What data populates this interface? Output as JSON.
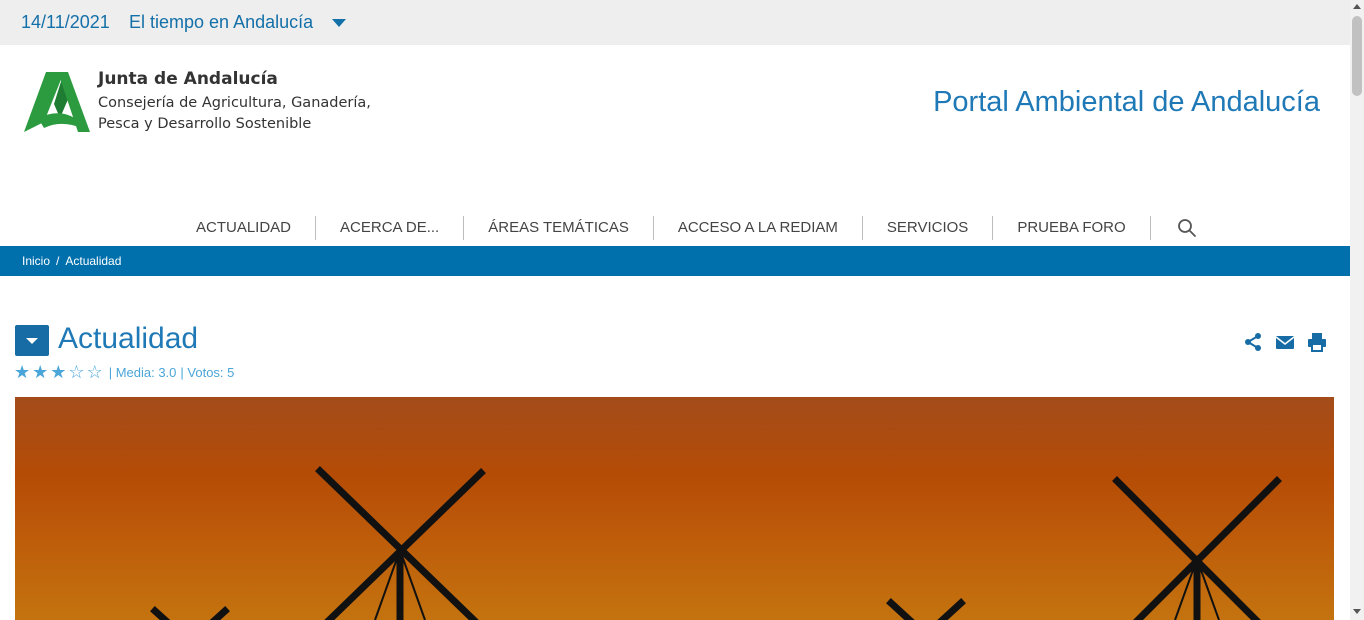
{
  "topbar": {
    "date": "14/11/2021",
    "weather_link": "El tiempo en Andalucía"
  },
  "header": {
    "org_name": "Junta de Andalucía",
    "org_dept_line1": "Consejería de Agricultura, Ganadería,",
    "org_dept_line2": "Pesca y Desarrollo Sostenible",
    "portal_title": "Portal Ambiental de Andalucía"
  },
  "nav": {
    "items": [
      {
        "label": "ACTUALIDAD"
      },
      {
        "label": "ACERCA DE..."
      },
      {
        "label": "ÁREAS TEMÁTICAS"
      },
      {
        "label": "ACCESO A LA REDIAM"
      },
      {
        "label": "SERVICIOS"
      },
      {
        "label": "PRUEBA FORO"
      }
    ],
    "search_icon": "search-icon"
  },
  "breadcrumb": {
    "home": "Inicio",
    "separator": "/",
    "current": "Actualidad"
  },
  "main": {
    "title": "Actualidad",
    "rating": {
      "filled_stars": 3,
      "max_stars": 5,
      "average_text": "| Media: 3.0",
      "votes_text": "| Votos: 5"
    },
    "tools": [
      "share-icon",
      "email-icon",
      "print-icon"
    ]
  },
  "colors": {
    "accent": "#1f79b6",
    "breadcrumb_bg": "#0070ad",
    "logo_green": "#2c9a3f",
    "hero_orange": "#b54c06"
  }
}
